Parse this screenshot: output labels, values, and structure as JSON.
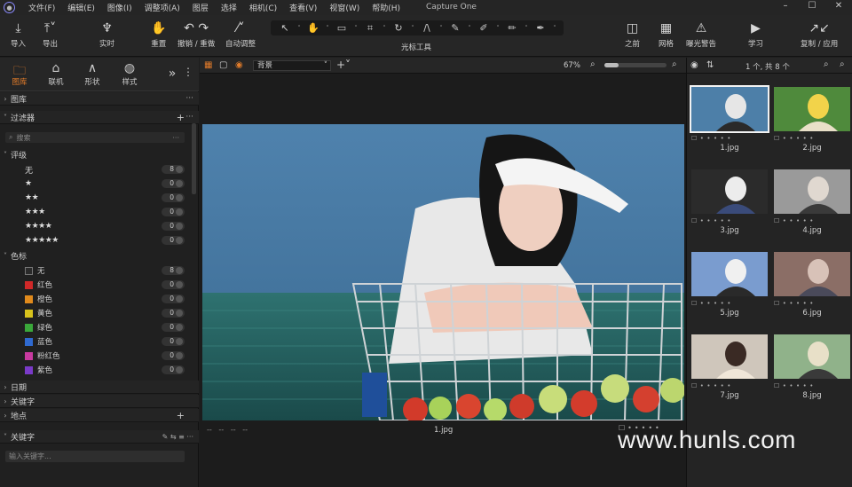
{
  "menu": {
    "items": [
      "文件(F)",
      "编辑(E)",
      "图像(I)",
      "调整项(A)",
      "图层",
      "选择",
      "相机(C)",
      "查看(V)",
      "视窗(W)",
      "帮助(H)"
    ],
    "window_title": "Capture One"
  },
  "toolbar": {
    "import": "导入",
    "export": "导出",
    "live": "实时",
    "reset": "重置",
    "undo_redo": "撤销 / 重做",
    "auto_adjust": "自动调整",
    "cursor_tools": "光标工具",
    "before": "之前",
    "grid": "网格",
    "exposure_warning": "曝光警告",
    "learn": "学习",
    "copy_apply": "复制 / 应用"
  },
  "left": {
    "tabs": [
      {
        "label": "图库",
        "active": true
      },
      {
        "label": "联机"
      },
      {
        "label": "形状"
      },
      {
        "label": "样式"
      }
    ],
    "library_title": "图库",
    "filters_title": "过滤器",
    "search_placeholder": "搜索",
    "rating_title": "评级",
    "ratings": [
      {
        "label": "无",
        "count": "8"
      },
      {
        "label": "★",
        "count": "0"
      },
      {
        "label": "★★",
        "count": "0"
      },
      {
        "label": "★★★",
        "count": "0"
      },
      {
        "label": "★★★★",
        "count": "0"
      },
      {
        "label": "★★★★★",
        "count": "0"
      }
    ],
    "color_title": "色标",
    "colors": [
      {
        "label": "无",
        "count": "8",
        "color": "#2a2a2a"
      },
      {
        "label": "红色",
        "count": "0",
        "color": "#d02828"
      },
      {
        "label": "橙色",
        "count": "0",
        "color": "#e08a1c"
      },
      {
        "label": "黄色",
        "count": "0",
        "color": "#d8c21c"
      },
      {
        "label": "绿色",
        "count": "0",
        "color": "#3aa83a"
      },
      {
        "label": "蓝色",
        "count": "0",
        "color": "#2f6ad0"
      },
      {
        "label": "粉红色",
        "count": "0",
        "color": "#c83aa0"
      },
      {
        "label": "紫色",
        "count": "0",
        "color": "#7a3ac8"
      }
    ],
    "date_title": "日期",
    "keyword_title": "关键字",
    "location_title": "地点",
    "keywords_panel_title": "关键字",
    "keyword_input_placeholder": "输入关键字..."
  },
  "center": {
    "layer_select": "背景",
    "zoom": "67%",
    "filename": "1.jpg",
    "meta_dashes": [
      "--",
      "--",
      "--",
      "--"
    ]
  },
  "right": {
    "count_text": "1 个, 共 8 个",
    "thumbs": [
      "1.jpg",
      "2.jpg",
      "3.jpg",
      "4.jpg",
      "5.jpg",
      "6.jpg",
      "7.jpg",
      "8.jpg"
    ]
  },
  "watermark": "www.hunls.com"
}
